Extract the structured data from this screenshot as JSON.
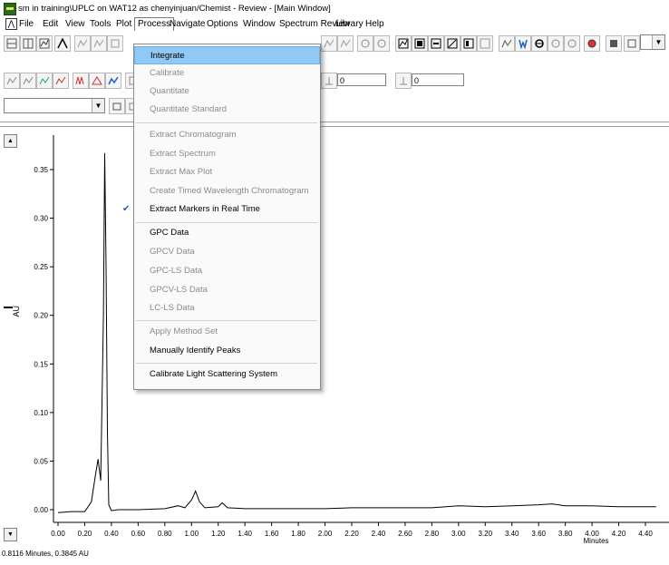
{
  "window": {
    "title": "sm in training\\UPLC on WAT12 as chenyinjuan/Chemist - Review - [Main Window]"
  },
  "menubar": {
    "items": [
      "File",
      "Edit",
      "View",
      "Tools",
      "Plot",
      "Process",
      "Navigate",
      "Options",
      "Window",
      "Spectrum Review",
      "Library",
      "Help"
    ],
    "active": "Process"
  },
  "toolbar": {
    "field_1": "0",
    "field_2": "0"
  },
  "process_menu": {
    "items": [
      {
        "label": "Integrate",
        "state": "highlighted"
      },
      {
        "label": "Calibrate",
        "state": "disabled"
      },
      {
        "label": "Quantitate",
        "state": "disabled"
      },
      {
        "label": "Quantitate Standard",
        "state": "disabled"
      },
      {
        "label": "Extract Chromatogram",
        "state": "disabled"
      },
      {
        "label": "Extract Spectrum",
        "state": "disabled"
      },
      {
        "label": "Extract Max Plot",
        "state": "disabled"
      },
      {
        "label": "Create Timed Wavelength Chromatogram",
        "state": "disabled"
      },
      {
        "label": "Extract Markers in Real Time",
        "state": "checked"
      },
      {
        "label": "GPC Data",
        "state": "enabled"
      },
      {
        "label": "GPCV Data",
        "state": "disabled"
      },
      {
        "label": "GPC-LS Data",
        "state": "disabled"
      },
      {
        "label": "GPCV-LS Data",
        "state": "disabled"
      },
      {
        "label": "LC-LS Data",
        "state": "disabled"
      },
      {
        "label": "Apply Method Set",
        "state": "disabled"
      },
      {
        "label": "Manually Identify Peaks",
        "state": "enabled"
      },
      {
        "label": "Calibrate Light Scattering System",
        "state": "enabled"
      }
    ]
  },
  "chart_data": {
    "type": "line",
    "ylabel": "AU",
    "xlabel": "Minutes",
    "xlim": [
      0,
      4.48
    ],
    "ylim": [
      -0.015,
      0.38
    ],
    "x_ticks": [
      "0.00",
      "0.20",
      "0.40",
      "0.60",
      "0.80",
      "1.00",
      "1.20",
      "1.40",
      "1.60",
      "1.80",
      "2.00",
      "2.20",
      "2.40",
      "2.60",
      "2.80",
      "3.00",
      "3.20",
      "3.40",
      "3.60",
      "3.80",
      "4.00",
      "4.20",
      "4.40"
    ],
    "y_ticks": [
      "0.00",
      "0.05",
      "0.10",
      "0.15",
      "0.20",
      "0.25",
      "0.30",
      "0.35"
    ],
    "series": [
      {
        "x": [
          0.0,
          0.1,
          0.2,
          0.25,
          0.28,
          0.3,
          0.32,
          0.34,
          0.35,
          0.36,
          0.37,
          0.38,
          0.4,
          0.45,
          0.6,
          0.8,
          0.9,
          0.95,
          1.0,
          1.03,
          1.06,
          1.1,
          1.2,
          1.23,
          1.27,
          1.4,
          1.6,
          2.0,
          2.2,
          2.4,
          2.6,
          2.8,
          3.0,
          3.2,
          3.4,
          3.6,
          3.7,
          3.8,
          4.0,
          4.2,
          4.48
        ],
        "y": [
          -0.003,
          -0.002,
          -0.002,
          0.008,
          0.035,
          0.052,
          0.03,
          0.2,
          0.367,
          0.25,
          0.08,
          0.005,
          -0.001,
          0.0,
          0.0,
          0.001,
          0.004,
          0.002,
          0.01,
          0.019,
          0.008,
          0.002,
          0.003,
          0.007,
          0.002,
          0.001,
          0.001,
          0.001,
          0.002,
          0.002,
          0.002,
          0.002,
          0.004,
          0.003,
          0.004,
          0.005,
          0.006,
          0.004,
          0.004,
          0.003,
          0.003
        ]
      }
    ]
  },
  "statusbar": {
    "cursor": "0.8116 Minutes, 0.3845 AU"
  },
  "colors": {
    "menu_highlight": "#90c8f6",
    "check_mark": "#1a5fc4"
  }
}
